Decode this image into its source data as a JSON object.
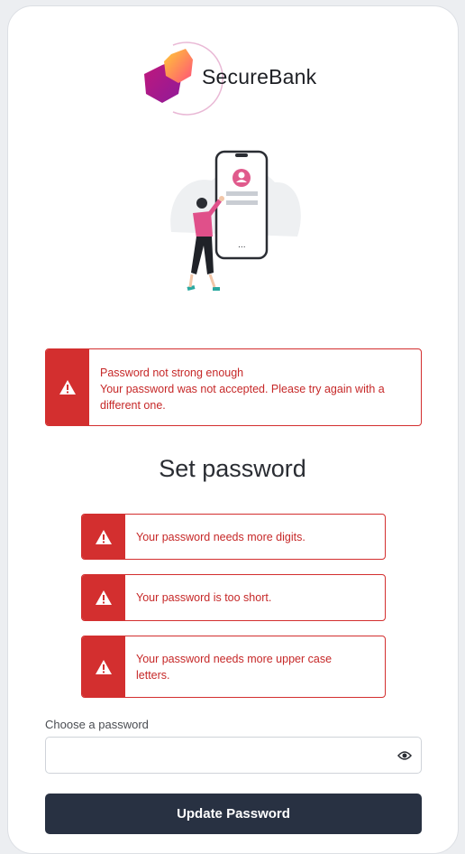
{
  "brand": {
    "name": "SecureBank"
  },
  "error_banner": {
    "title": "Password not strong enough",
    "message": "Your password was not accepted. Please try again with a different one."
  },
  "page": {
    "title": "Set password"
  },
  "requirements": [
    {
      "text": "Your password needs more digits."
    },
    {
      "text": "Your password is too short."
    },
    {
      "text": "Your password needs more upper case letters."
    }
  ],
  "password_field": {
    "label": "Choose a password",
    "value": ""
  },
  "submit": {
    "label": "Update Password"
  },
  "colors": {
    "error": "#d32f2f",
    "button": "#283142"
  },
  "icons": {
    "alert": "warning-triangle-icon",
    "visibility": "eye-icon"
  }
}
